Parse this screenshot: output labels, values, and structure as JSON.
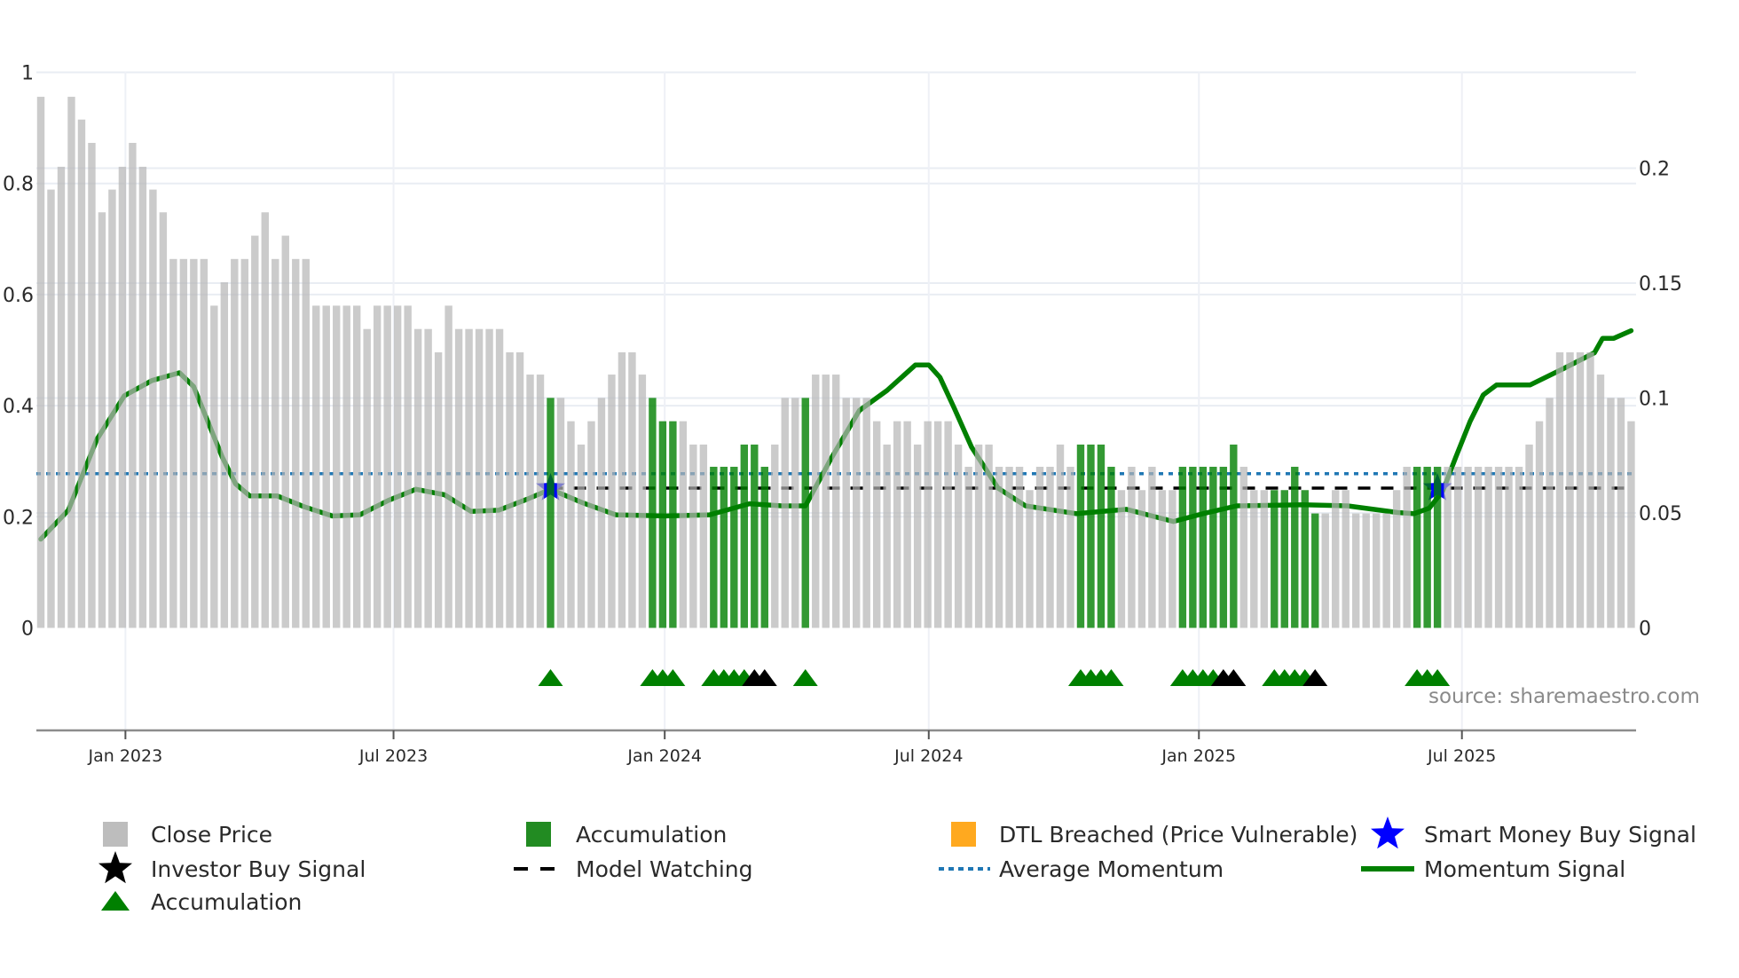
{
  "chart_data": {
    "type": "bar",
    "title": "",
    "xlabel": "",
    "ylabel": "",
    "x_ticks": [
      "Jan 2023",
      "Jul 2023",
      "Jan 2024",
      "Jul 2024",
      "Jan 2025",
      "Jul 2025"
    ],
    "x_tick_bar_index": [
      9.3,
      35.6,
      62.2,
      88.1,
      114.6,
      140.4
    ],
    "left_axis": {
      "ylim": [
        0,
        1
      ],
      "ticks": [
        "0",
        "0.2",
        "0.4",
        "0.6",
        "0.8",
        "1"
      ],
      "tick_values": [
        0,
        0.2,
        0.4,
        0.6,
        0.8,
        1
      ]
    },
    "right_axis": {
      "ylim": [
        0,
        0.2417
      ],
      "ticks": [
        "0",
        "0.05",
        "0.1",
        "0.15",
        "0.2"
      ],
      "tick_values": [
        0,
        0.05,
        0.1,
        0.15,
        0.2
      ]
    },
    "grid": true,
    "close_price": [
      0.956,
      0.789,
      0.83,
      0.956,
      0.915,
      0.873,
      0.748,
      0.789,
      0.83,
      0.873,
      0.83,
      0.789,
      0.748,
      0.664,
      0.664,
      0.664,
      0.664,
      0.58,
      0.622,
      0.664,
      0.664,
      0.706,
      0.748,
      0.664,
      0.706,
      0.664,
      0.664,
      0.58,
      0.58,
      0.58,
      0.58,
      0.58,
      0.538,
      0.58,
      0.58,
      0.58,
      0.58,
      0.538,
      0.538,
      0.496,
      0.58,
      0.538,
      0.538,
      0.538,
      0.538,
      0.538,
      0.496,
      0.496,
      0.456,
      0.456,
      0.414,
      0.414,
      0.372,
      0.33,
      0.372,
      0.414,
      0.456,
      0.496,
      0.496,
      0.456,
      0.414,
      0.372,
      0.372,
      0.372,
      0.33,
      0.33,
      0.29,
      0.29,
      0.29,
      0.33,
      0.33,
      0.29,
      0.33,
      0.414,
      0.414,
      0.414,
      0.456,
      0.456,
      0.456,
      0.414,
      0.414,
      0.414,
      0.372,
      0.33,
      0.372,
      0.372,
      0.33,
      0.372,
      0.372,
      0.372,
      0.33,
      0.29,
      0.33,
      0.33,
      0.29,
      0.29,
      0.29,
      0.248,
      0.29,
      0.29,
      0.33,
      0.29,
      0.33,
      0.33,
      0.33,
      0.29,
      0.248,
      0.29,
      0.248,
      0.29,
      0.248,
      0.248,
      0.29,
      0.29,
      0.29,
      0.29,
      0.29,
      0.33,
      0.29,
      0.248,
      0.248,
      0.248,
      0.248,
      0.29,
      0.248,
      0.206,
      0.206,
      0.248,
      0.248,
      0.206,
      0.206,
      0.206,
      0.206,
      0.248,
      0.29,
      0.29,
      0.29,
      0.29,
      0.29,
      0.29,
      0.29,
      0.29,
      0.29,
      0.29,
      0.29,
      0.29,
      0.33,
      0.372,
      0.414,
      0.496,
      0.496,
      0.496,
      0.496,
      0.456,
      0.414,
      0.414,
      0.372
    ],
    "accumulation_bars": [
      51,
      61,
      62,
      63,
      67,
      68,
      69,
      70,
      71,
      72,
      76,
      103,
      104,
      105,
      106,
      113,
      114,
      115,
      116,
      117,
      118,
      122,
      123,
      124,
      125,
      126,
      136,
      137,
      138
    ],
    "accumulation_triangles": [
      51,
      61,
      62,
      63,
      67,
      68,
      69,
      70,
      76,
      103,
      104,
      105,
      106,
      113,
      114,
      115,
      116,
      122,
      123,
      124,
      125,
      136,
      137,
      138
    ],
    "black_triangles": [
      71,
      72,
      117,
      118,
      126
    ],
    "smart_money_buy_signal": [
      {
        "bar": 51,
        "value": 0.0608
      },
      {
        "bar": 138,
        "value": 0.0608
      }
    ],
    "model_watching": {
      "from_bar": 51,
      "to_bar": 157,
      "value": 0.0608
    },
    "average_momentum": 0.0671,
    "momentum_signal": [
      [
        1,
        0.0386
      ],
      [
        3.7,
        0.0512
      ],
      [
        6.5,
        0.082
      ],
      [
        9.2,
        0.101
      ],
      [
        11.9,
        0.1076
      ],
      [
        14.6,
        0.111
      ],
      [
        16,
        0.105
      ],
      [
        17.3,
        0.0907
      ],
      [
        18.8,
        0.0743
      ],
      [
        20.1,
        0.0627
      ],
      [
        21.5,
        0.0574
      ],
      [
        24.2,
        0.0574
      ],
      [
        26.9,
        0.0526
      ],
      [
        29.6,
        0.0487
      ],
      [
        32.3,
        0.0492
      ],
      [
        35.1,
        0.0555
      ],
      [
        37.8,
        0.0603
      ],
      [
        40.6,
        0.0579
      ],
      [
        43.2,
        0.0507
      ],
      [
        45.9,
        0.0512
      ],
      [
        48.7,
        0.056
      ],
      [
        51,
        0.0603
      ],
      [
        54.1,
        0.0545
      ],
      [
        57.4,
        0.0492
      ],
      [
        62.2,
        0.0487
      ],
      [
        66.6,
        0.0492
      ],
      [
        70.5,
        0.054
      ],
      [
        73.7,
        0.0531
      ],
      [
        76,
        0.0531
      ],
      [
        78.6,
        0.0743
      ],
      [
        81.3,
        0.0946
      ],
      [
        84,
        0.1033
      ],
      [
        86.8,
        0.1144
      ],
      [
        88.1,
        0.1144
      ],
      [
        89.2,
        0.109
      ],
      [
        90.6,
        0.0956
      ],
      [
        92.3,
        0.0787
      ],
      [
        94.9,
        0.0608
      ],
      [
        97.6,
        0.0531
      ],
      [
        102.6,
        0.0497
      ],
      [
        107.5,
        0.0516
      ],
      [
        112.1,
        0.0463
      ],
      [
        115,
        0.0497
      ],
      [
        118.3,
        0.0531
      ],
      [
        124.8,
        0.0536
      ],
      [
        129.2,
        0.0531
      ],
      [
        134.1,
        0.0502
      ],
      [
        135.7,
        0.0497
      ],
      [
        137.2,
        0.0521
      ],
      [
        138.5,
        0.0594
      ],
      [
        139.8,
        0.0743
      ],
      [
        141.2,
        0.0898
      ],
      [
        142.5,
        0.1014
      ],
      [
        143.8,
        0.1057
      ],
      [
        147.1,
        0.1057
      ],
      [
        150.4,
        0.1129
      ],
      [
        153.4,
        0.1197
      ],
      [
        154.2,
        0.126
      ],
      [
        155.3,
        0.126
      ],
      [
        157,
        0.1293
      ]
    ],
    "source": "source: sharemaestro.com",
    "legend_position": "bottom",
    "legend": [
      {
        "label": "Close Price",
        "symbol": "gray-square",
        "color": "#bdbdbd"
      },
      {
        "label": "Accumulation",
        "symbol": "green-square",
        "color": "#228b22"
      },
      {
        "label": "DTL Breached (Price Vulnerable)",
        "symbol": "orange-square",
        "color": "#ffa91f"
      },
      {
        "label": "Smart Money Buy Signal",
        "symbol": "blue-star",
        "color": "#0000ff"
      },
      {
        "label": "Investor Buy Signal",
        "symbol": "black-star",
        "color": "#000000"
      },
      {
        "label": "Model Watching",
        "symbol": "dashed-line",
        "color": "#000000"
      },
      {
        "label": "Average Momentum",
        "symbol": "dotted-line",
        "color": "#1f77b4"
      },
      {
        "label": "Momentum Signal",
        "symbol": "solid-line",
        "color": "#008000"
      },
      {
        "label": "Accumulation",
        "symbol": "green-triangle",
        "color": "#008000"
      }
    ]
  }
}
